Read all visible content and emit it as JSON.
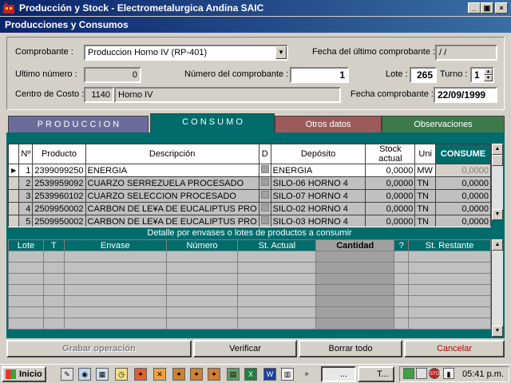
{
  "window": {
    "title": "Producción y Stock - Electrometalurgica Andina SAIC",
    "subtitle": "Producciones y Consumos"
  },
  "header": {
    "comprobante_label": "Comprobante :",
    "comprobante_value": "Produccion Horno IV (RP-401)",
    "fecha_ultimo_label": "Fecha del último comprobante :",
    "fecha_ultimo_value": " /  /",
    "ultimo_numero_label": "Ultimo número :",
    "ultimo_numero_value": "0",
    "numero_comprobante_label": "Número del comprobante :",
    "numero_comprobante_value": "1",
    "lote_label": "Lote :",
    "lote_value": "265",
    "turno_label": "Turno :",
    "turno_value": "1",
    "centro_costo_label": "Centro de Costo :",
    "centro_costo_code": "1140",
    "centro_costo_name": "Horno  IV",
    "fecha_comprobante_label": "Fecha comprobante :",
    "fecha_comprobante_value": "22/09/1999"
  },
  "tabs": [
    {
      "label": "P R O D U C C I O N",
      "color": "#6c6c9c",
      "text_color": "#ffffff"
    },
    {
      "label": "C O N S U M O",
      "color": "#006c6c",
      "text_color": "#ffffff"
    },
    {
      "label": "Otros datos",
      "color": "#9c5a5a",
      "text_color": "#ffffff"
    },
    {
      "label": "Observaciones",
      "color": "#3c7a4c",
      "text_color": "#ffffff"
    }
  ],
  "consumo_table": {
    "columns": [
      "Nº",
      "Producto",
      "Descripción",
      "D",
      "Depósito",
      "Stock actual",
      "Uni",
      "CONSUME"
    ],
    "rows": [
      {
        "n": "1",
        "producto": "2399099250",
        "descripcion": "ENERGIA",
        "deposito": "ENERGIA",
        "stock": "0,0000",
        "uni": "MW",
        "consume": "0,0000"
      },
      {
        "n": "2",
        "producto": "2539959092",
        "descripcion": "CUARZO SERREZUELA PROCESADO",
        "deposito": "SILO-06 HORNO 4",
        "stock": "0,0000",
        "uni": "TN",
        "consume": "0,0000"
      },
      {
        "n": "3",
        "producto": "2539960102",
        "descripcion": "CUARZO SELECCION PROCESADO",
        "deposito": "SILO-07 HORNO 4",
        "stock": "0,0000",
        "uni": "TN",
        "consume": "0,0000"
      },
      {
        "n": "4",
        "producto": "2509950002",
        "descripcion": "CARBON DE LE¥A DE EUCALIPTUS PRO",
        "deposito": "SILO-02 HORNO 4",
        "stock": "0,0000",
        "uni": "TN",
        "consume": "0,0000"
      },
      {
        "n": "5",
        "producto": "2509950002",
        "descripcion": "CARBON DE LE¥A DE EUCALIPTUS PRO",
        "deposito": "SILO-03 HORNO 4",
        "stock": "0,0000",
        "uni": "TN",
        "consume": "0,0000"
      }
    ]
  },
  "detalle": {
    "title": "Detalle por envases o lotes de productos a consumir",
    "columns": [
      "Lote",
      "T",
      "Envase",
      "Número",
      "St. Actual",
      "Cantidad",
      "?",
      "St. Restante"
    ]
  },
  "buttons": {
    "grabar": "Grabar operación",
    "verificar": "Verificar",
    "borrar": "Borrar todo",
    "cancelar": "Cancelar"
  },
  "taskbar": {
    "start": "Inicio",
    "task1": "...",
    "task2": "T...",
    "clock": "05:41 p.m."
  }
}
